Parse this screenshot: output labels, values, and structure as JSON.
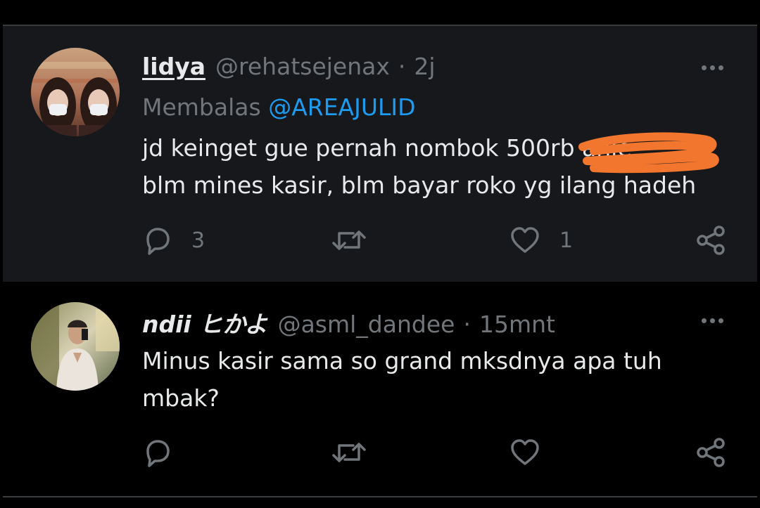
{
  "tweets": [
    {
      "name": "lidya",
      "handle": "@rehatsejenax",
      "separator": "·",
      "time": "2j",
      "reply_prefix": "Membalas",
      "reply_to": "@AREAJULID",
      "text_line1": "jd keinget gue pernah nombok 500rb anje",
      "text_line2": "blm mines kasir, blm bayar roko yg ilang hadeh",
      "counts": {
        "reply": "3",
        "retweet": "",
        "like": "1"
      }
    },
    {
      "name": "ndii ヒかよ",
      "handle": "@asml_dandee",
      "separator": "·",
      "time": "15mnt",
      "text_line1": "Minus kasir sama so grand mksdnya apa tuh",
      "text_line2": "mbak?",
      "counts": {
        "reply": "",
        "retweet": "",
        "like": ""
      }
    }
  ],
  "icons": {
    "more": "more-icon",
    "reply": "reply-icon",
    "retweet": "retweet-icon",
    "like": "like-icon",
    "share": "share-icon"
  },
  "colors": {
    "background": "#000000",
    "reply_row_background": "#16181c",
    "text": "#e7e9ea",
    "muted": "#71767b",
    "accent": "#1d9bf0",
    "scribble": "#f2762e"
  }
}
